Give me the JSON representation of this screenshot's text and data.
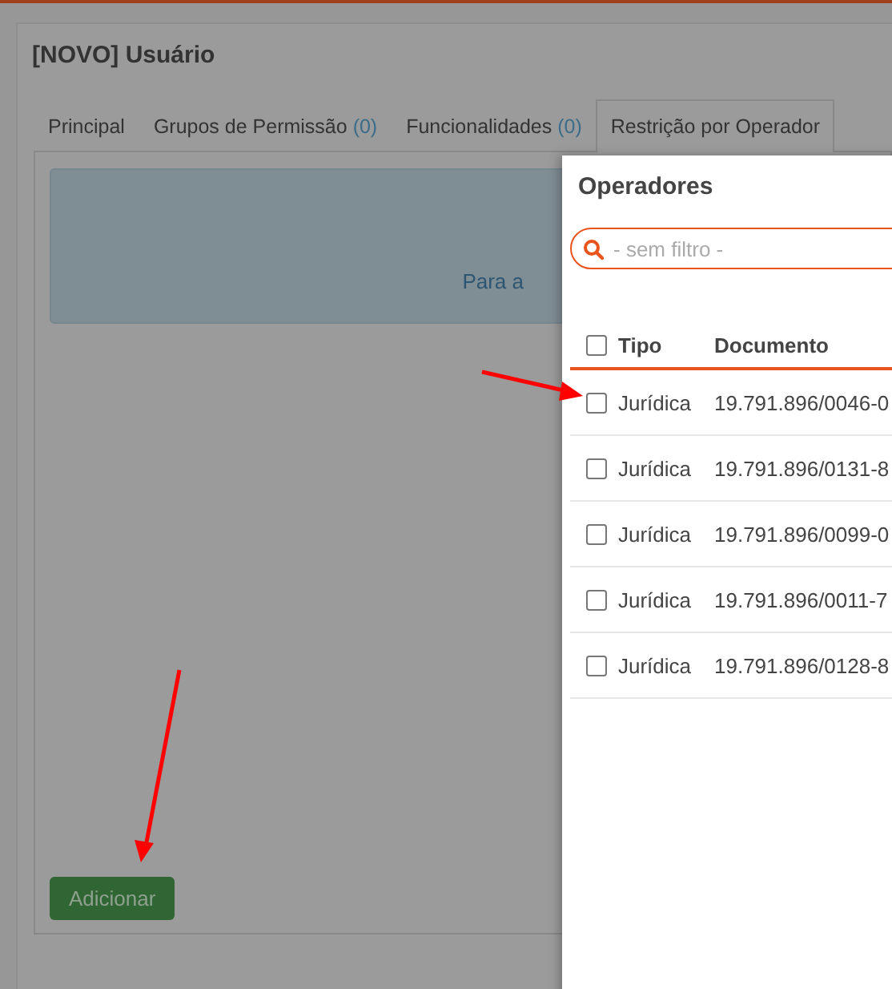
{
  "dialog": {
    "title": "[NOVO] Usuário",
    "tabs": [
      {
        "label": "Principal",
        "selected": false
      },
      {
        "label": "Grupos de Permissão",
        "count": "(0)",
        "selected": false
      },
      {
        "label": "Funcionalidades",
        "count": "(0)",
        "selected": false
      },
      {
        "label": "Restrição por Operador",
        "selected": true
      }
    ],
    "info_text": "Para a",
    "add_button": "Adicionar"
  },
  "popup": {
    "title": "Operadores",
    "search": {
      "placeholder": "- sem filtro -"
    },
    "table": {
      "select_all": {
        "checked": false
      },
      "columns": [
        "Tipo",
        "Documento"
      ],
      "rows": [
        {
          "checked": false,
          "tipo": "Jurídica",
          "documento": "19.791.896/0046-0"
        },
        {
          "checked": false,
          "tipo": "Jurídica",
          "documento": "19.791.896/0131-8"
        },
        {
          "checked": false,
          "tipo": "Jurídica",
          "documento": "19.791.896/0099-0"
        },
        {
          "checked": false,
          "tipo": "Jurídica",
          "documento": "19.791.896/0011-7"
        },
        {
          "checked": false,
          "tipo": "Jurídica",
          "documento": "19.791.896/0128-8"
        }
      ]
    }
  }
}
